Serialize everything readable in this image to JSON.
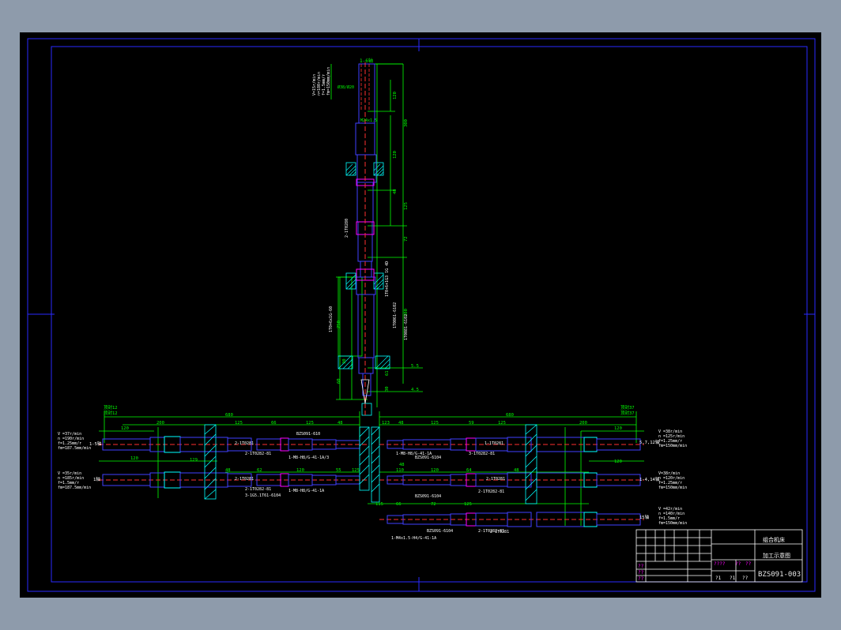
{
  "colors": {
    "frame": "#2a2aff",
    "axis": "#ff3030",
    "part": "#4040ff",
    "dim": "#00ff00",
    "hatch": "#00ffff",
    "text_white": "#ffffff"
  },
  "titleblock": {
    "title_line1": "组合机床",
    "title_line2": "加工示意图",
    "drawing_no": "BZS091-003",
    "scale_cells": [
      "????",
      "??",
      "??"
    ],
    "sheet_cells": [
      "?1",
      "?1",
      "??"
    ],
    "row_marks": [
      "??",
      "??",
      "??"
    ]
  },
  "vertical_head": {
    "label": "1-6轴",
    "cutting_params": [
      "V=15r/min",
      "n=180r/min",
      "f=1.5mm/r",
      "fm=150mm/min"
    ],
    "drill_label": "Ø38/Ø20",
    "thread_label": "M24x1.5",
    "dims": [
      "120",
      "300",
      "120",
      "48",
      "125",
      "72",
      "300",
      "5.5",
      "4.5",
      "60",
      "250",
      "30",
      "61",
      "30"
    ],
    "notes": [
      "2-1T0280",
      "1T0061-6102",
      "1T0081-6102",
      "1T0+6+1G3 1G 4D",
      "1T0+6x1G-60"
    ]
  },
  "left_head": {
    "label_top": "顶封12",
    "label_top2": "顶封12",
    "axis1": "1-5轴",
    "axis2": "1轴",
    "params1": [
      "V =37r/min",
      "n =190r/min",
      "f=1.25mm/r",
      "fm=187.5mm/min"
    ],
    "params2": [
      "V =35r/min",
      "n =185r/min",
      "f=1.5mm/r",
      "fm=187.5mm/min"
    ],
    "dims": [
      "680",
      "200",
      "120",
      "125",
      "66",
      "125",
      "48",
      "120",
      "48",
      "62",
      "120",
      "55",
      "125",
      "129"
    ],
    "notes": [
      "2-1T0281",
      "2-1T0282-81",
      "1-M8-H8/G-41-1A/3",
      "BZS091-610",
      "2-1T0281",
      "2-1T0282-81",
      "3-1G5.1T61-6104",
      "1-M8-H8/G-41-1A"
    ]
  },
  "right_head": {
    "label_top": "顶封37",
    "label_top2": "顶封37",
    "axis1": "5,7,12轴",
    "axis2": "1-4,14轴",
    "axis3": "15轴",
    "params1": [
      "V =38r/min",
      "n =125r/min",
      "f=1.25mm/r",
      "fm=150mm/min"
    ],
    "params2": [
      "V=38r/min",
      "n =120r/min",
      "f=1.25mm/r",
      "fm=150mm/min"
    ],
    "params3": [
      "V =42r/min",
      "n =140r/min",
      "f=1.5mm/r",
      "fm=150mm/min"
    ],
    "dims": [
      "680",
      "200",
      "125",
      "59",
      "125",
      "48",
      "120",
      "120",
      "64",
      "48",
      "110",
      "72",
      "125",
      "66",
      "120",
      "115",
      "48",
      "123"
    ],
    "notes": [
      "1-1T0281",
      "BZS091-6104",
      "3-1T0282-81",
      "1-M8-H8/G-41-1A",
      "2-1T0281",
      "BZS091-6104",
      "2-1T0282-81",
      "2-1T0281",
      "BZS091-6104",
      "2-1T0282-81",
      "1-M4x1.5-H4/G-41-1A"
    ]
  }
}
